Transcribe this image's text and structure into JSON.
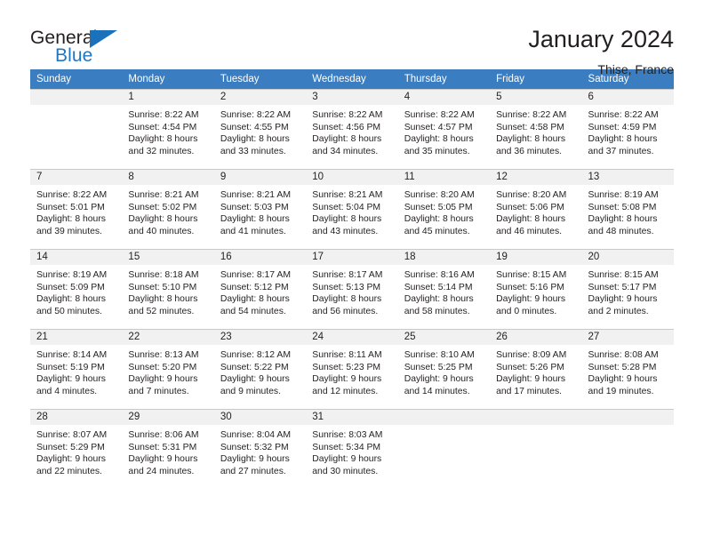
{
  "brand": {
    "name_part1": "General",
    "name_part2": "Blue",
    "flag_icon": "triangle-flag-icon"
  },
  "header": {
    "title": "January 2024",
    "location": "Thise, France"
  },
  "calendar": {
    "accent_color": "#3a7dc0",
    "daynum_bg": "#f1f1f1",
    "weekday_headers": [
      "Sunday",
      "Monday",
      "Tuesday",
      "Wednesday",
      "Thursday",
      "Friday",
      "Saturday"
    ],
    "weeks": [
      [
        {
          "day": "",
          "sunrise": "",
          "sunset": "",
          "daylight_line1": "",
          "daylight_line2": ""
        },
        {
          "day": "1",
          "sunrise": "Sunrise: 8:22 AM",
          "sunset": "Sunset: 4:54 PM",
          "daylight_line1": "Daylight: 8 hours",
          "daylight_line2": "and 32 minutes."
        },
        {
          "day": "2",
          "sunrise": "Sunrise: 8:22 AM",
          "sunset": "Sunset: 4:55 PM",
          "daylight_line1": "Daylight: 8 hours",
          "daylight_line2": "and 33 minutes."
        },
        {
          "day": "3",
          "sunrise": "Sunrise: 8:22 AM",
          "sunset": "Sunset: 4:56 PM",
          "daylight_line1": "Daylight: 8 hours",
          "daylight_line2": "and 34 minutes."
        },
        {
          "day": "4",
          "sunrise": "Sunrise: 8:22 AM",
          "sunset": "Sunset: 4:57 PM",
          "daylight_line1": "Daylight: 8 hours",
          "daylight_line2": "and 35 minutes."
        },
        {
          "day": "5",
          "sunrise": "Sunrise: 8:22 AM",
          "sunset": "Sunset: 4:58 PM",
          "daylight_line1": "Daylight: 8 hours",
          "daylight_line2": "and 36 minutes."
        },
        {
          "day": "6",
          "sunrise": "Sunrise: 8:22 AM",
          "sunset": "Sunset: 4:59 PM",
          "daylight_line1": "Daylight: 8 hours",
          "daylight_line2": "and 37 minutes."
        }
      ],
      [
        {
          "day": "7",
          "sunrise": "Sunrise: 8:22 AM",
          "sunset": "Sunset: 5:01 PM",
          "daylight_line1": "Daylight: 8 hours",
          "daylight_line2": "and 39 minutes."
        },
        {
          "day": "8",
          "sunrise": "Sunrise: 8:21 AM",
          "sunset": "Sunset: 5:02 PM",
          "daylight_line1": "Daylight: 8 hours",
          "daylight_line2": "and 40 minutes."
        },
        {
          "day": "9",
          "sunrise": "Sunrise: 8:21 AM",
          "sunset": "Sunset: 5:03 PM",
          "daylight_line1": "Daylight: 8 hours",
          "daylight_line2": "and 41 minutes."
        },
        {
          "day": "10",
          "sunrise": "Sunrise: 8:21 AM",
          "sunset": "Sunset: 5:04 PM",
          "daylight_line1": "Daylight: 8 hours",
          "daylight_line2": "and 43 minutes."
        },
        {
          "day": "11",
          "sunrise": "Sunrise: 8:20 AM",
          "sunset": "Sunset: 5:05 PM",
          "daylight_line1": "Daylight: 8 hours",
          "daylight_line2": "and 45 minutes."
        },
        {
          "day": "12",
          "sunrise": "Sunrise: 8:20 AM",
          "sunset": "Sunset: 5:06 PM",
          "daylight_line1": "Daylight: 8 hours",
          "daylight_line2": "and 46 minutes."
        },
        {
          "day": "13",
          "sunrise": "Sunrise: 8:19 AM",
          "sunset": "Sunset: 5:08 PM",
          "daylight_line1": "Daylight: 8 hours",
          "daylight_line2": "and 48 minutes."
        }
      ],
      [
        {
          "day": "14",
          "sunrise": "Sunrise: 8:19 AM",
          "sunset": "Sunset: 5:09 PM",
          "daylight_line1": "Daylight: 8 hours",
          "daylight_line2": "and 50 minutes."
        },
        {
          "day": "15",
          "sunrise": "Sunrise: 8:18 AM",
          "sunset": "Sunset: 5:10 PM",
          "daylight_line1": "Daylight: 8 hours",
          "daylight_line2": "and 52 minutes."
        },
        {
          "day": "16",
          "sunrise": "Sunrise: 8:17 AM",
          "sunset": "Sunset: 5:12 PM",
          "daylight_line1": "Daylight: 8 hours",
          "daylight_line2": "and 54 minutes."
        },
        {
          "day": "17",
          "sunrise": "Sunrise: 8:17 AM",
          "sunset": "Sunset: 5:13 PM",
          "daylight_line1": "Daylight: 8 hours",
          "daylight_line2": "and 56 minutes."
        },
        {
          "day": "18",
          "sunrise": "Sunrise: 8:16 AM",
          "sunset": "Sunset: 5:14 PM",
          "daylight_line1": "Daylight: 8 hours",
          "daylight_line2": "and 58 minutes."
        },
        {
          "day": "19",
          "sunrise": "Sunrise: 8:15 AM",
          "sunset": "Sunset: 5:16 PM",
          "daylight_line1": "Daylight: 9 hours",
          "daylight_line2": "and 0 minutes."
        },
        {
          "day": "20",
          "sunrise": "Sunrise: 8:15 AM",
          "sunset": "Sunset: 5:17 PM",
          "daylight_line1": "Daylight: 9 hours",
          "daylight_line2": "and 2 minutes."
        }
      ],
      [
        {
          "day": "21",
          "sunrise": "Sunrise: 8:14 AM",
          "sunset": "Sunset: 5:19 PM",
          "daylight_line1": "Daylight: 9 hours",
          "daylight_line2": "and 4 minutes."
        },
        {
          "day": "22",
          "sunrise": "Sunrise: 8:13 AM",
          "sunset": "Sunset: 5:20 PM",
          "daylight_line1": "Daylight: 9 hours",
          "daylight_line2": "and 7 minutes."
        },
        {
          "day": "23",
          "sunrise": "Sunrise: 8:12 AM",
          "sunset": "Sunset: 5:22 PM",
          "daylight_line1": "Daylight: 9 hours",
          "daylight_line2": "and 9 minutes."
        },
        {
          "day": "24",
          "sunrise": "Sunrise: 8:11 AM",
          "sunset": "Sunset: 5:23 PM",
          "daylight_line1": "Daylight: 9 hours",
          "daylight_line2": "and 12 minutes."
        },
        {
          "day": "25",
          "sunrise": "Sunrise: 8:10 AM",
          "sunset": "Sunset: 5:25 PM",
          "daylight_line1": "Daylight: 9 hours",
          "daylight_line2": "and 14 minutes."
        },
        {
          "day": "26",
          "sunrise": "Sunrise: 8:09 AM",
          "sunset": "Sunset: 5:26 PM",
          "daylight_line1": "Daylight: 9 hours",
          "daylight_line2": "and 17 minutes."
        },
        {
          "day": "27",
          "sunrise": "Sunrise: 8:08 AM",
          "sunset": "Sunset: 5:28 PM",
          "daylight_line1": "Daylight: 9 hours",
          "daylight_line2": "and 19 minutes."
        }
      ],
      [
        {
          "day": "28",
          "sunrise": "Sunrise: 8:07 AM",
          "sunset": "Sunset: 5:29 PM",
          "daylight_line1": "Daylight: 9 hours",
          "daylight_line2": "and 22 minutes."
        },
        {
          "day": "29",
          "sunrise": "Sunrise: 8:06 AM",
          "sunset": "Sunset: 5:31 PM",
          "daylight_line1": "Daylight: 9 hours",
          "daylight_line2": "and 24 minutes."
        },
        {
          "day": "30",
          "sunrise": "Sunrise: 8:04 AM",
          "sunset": "Sunset: 5:32 PM",
          "daylight_line1": "Daylight: 9 hours",
          "daylight_line2": "and 27 minutes."
        },
        {
          "day": "31",
          "sunrise": "Sunrise: 8:03 AM",
          "sunset": "Sunset: 5:34 PM",
          "daylight_line1": "Daylight: 9 hours",
          "daylight_line2": "and 30 minutes."
        },
        {
          "day": "",
          "sunrise": "",
          "sunset": "",
          "daylight_line1": "",
          "daylight_line2": ""
        },
        {
          "day": "",
          "sunrise": "",
          "sunset": "",
          "daylight_line1": "",
          "daylight_line2": ""
        },
        {
          "day": "",
          "sunrise": "",
          "sunset": "",
          "daylight_line1": "",
          "daylight_line2": ""
        }
      ]
    ]
  }
}
